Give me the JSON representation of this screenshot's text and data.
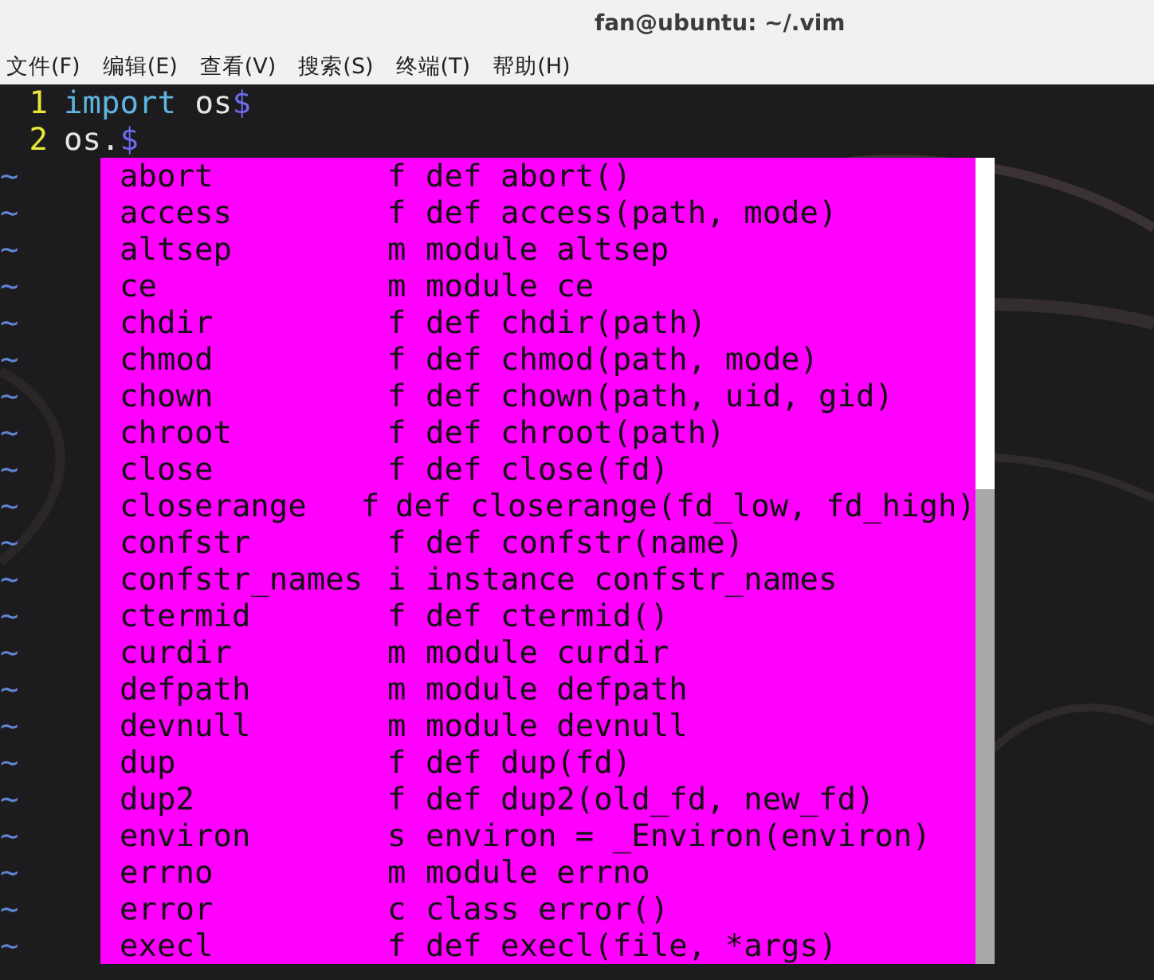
{
  "window": {
    "title": "fan@ubuntu: ~/.vim"
  },
  "menu": [
    "文件(F)",
    "编辑(E)",
    "查看(V)",
    "搜索(S)",
    "终端(T)",
    "帮助(H)"
  ],
  "buffer_lines": [
    {
      "number": "1",
      "segments": [
        {
          "kind": "keyword",
          "text": "import"
        },
        {
          "kind": "text",
          "text": " os"
        },
        {
          "kind": "eol",
          "text": "$"
        }
      ]
    },
    {
      "number": "2",
      "segments": [
        {
          "kind": "text",
          "text": "os."
        },
        {
          "kind": "eol",
          "text": "$"
        }
      ]
    }
  ],
  "filler_lines": [
    "~",
    "~",
    "~",
    "~",
    "~",
    "~",
    "~",
    "~",
    "~",
    "~",
    "~",
    "~",
    "~",
    "~",
    "~",
    "~",
    "~",
    "~",
    "~",
    "~",
    "~",
    "~"
  ],
  "completion_menu": {
    "items": [
      {
        "word": "abort",
        "kind": "f",
        "info": "def abort()"
      },
      {
        "word": "access",
        "kind": "f",
        "info": "def access(path, mode)"
      },
      {
        "word": "altsep",
        "kind": "m",
        "info": "module altsep"
      },
      {
        "word": "ce",
        "kind": "m",
        "info": "module ce"
      },
      {
        "word": "chdir",
        "kind": "f",
        "info": "def chdir(path)"
      },
      {
        "word": "chmod",
        "kind": "f",
        "info": "def chmod(path, mode)"
      },
      {
        "word": "chown",
        "kind": "f",
        "info": "def chown(path, uid, gid)"
      },
      {
        "word": "chroot",
        "kind": "f",
        "info": "def chroot(path)"
      },
      {
        "word": "close",
        "kind": "f",
        "info": "def close(fd)"
      },
      {
        "word": "closerange",
        "kind": "f",
        "info": "def closerange(fd_low, fd_high)"
      },
      {
        "word": "confstr",
        "kind": "f",
        "info": "def confstr(name)"
      },
      {
        "word": "confstr_names",
        "kind": "i",
        "info": "instance confstr_names"
      },
      {
        "word": "ctermid",
        "kind": "f",
        "info": "def ctermid()"
      },
      {
        "word": "curdir",
        "kind": "m",
        "info": "module curdir"
      },
      {
        "word": "defpath",
        "kind": "m",
        "info": "module defpath"
      },
      {
        "word": "devnull",
        "kind": "m",
        "info": "module devnull"
      },
      {
        "word": "dup",
        "kind": "f",
        "info": "def dup(fd)"
      },
      {
        "word": "dup2",
        "kind": "f",
        "info": "def dup2(old_fd, new_fd)"
      },
      {
        "word": "environ",
        "kind": "s",
        "info": "environ = _Environ(environ)"
      },
      {
        "word": "errno",
        "kind": "m",
        "info": "module errno"
      },
      {
        "word": "error",
        "kind": "c",
        "info": "class error()"
      },
      {
        "word": "execl",
        "kind": "f",
        "info": "def execl(file, *args)"
      }
    ]
  }
}
